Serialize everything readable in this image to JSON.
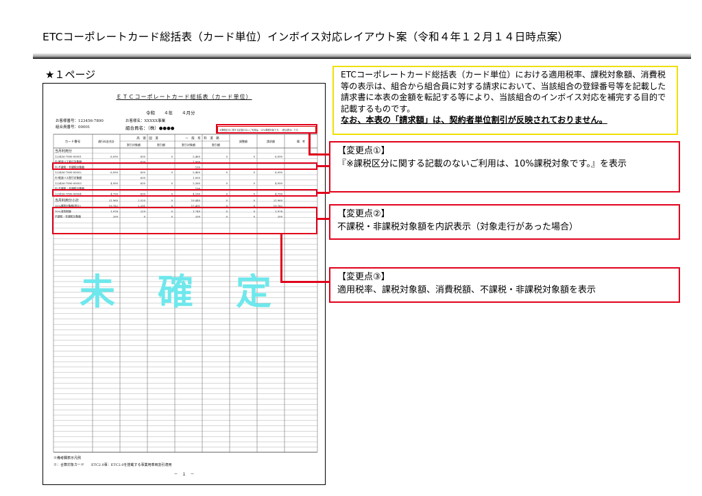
{
  "header": {
    "title": "ETCコーポレートカード総括表（カード単位）インボイス対応レイアウト案（令和４年１２月１４日時点案）"
  },
  "page_label": "★１ページ",
  "document": {
    "title": "ＥＴＣコーポレートカード総括表（カード単位）",
    "period": "令和　　４年　　４月分",
    "customer_no": "お客様番号：123456-7890",
    "customer_name": "お客様名：XXXXX事業",
    "member_no": "組合員番号：00001",
    "member_name": "組合員名：（株）●●●●",
    "stamp_note": "※課税区分に関する記載のないご利用は、10%課税対象です。（税込表示）です。",
    "headers": {
      "card_no": "カード番号",
      "total_before": "通行料金合計",
      "expressway": "高　速　国　道",
      "expressway_sub1": "割引対象額",
      "expressway_sub2": "割引額",
      "toll": "一　般　有　料　道　路",
      "toll_sub1": "割引対象額",
      "toll_sub2": "割引額",
      "adjust": "調整額",
      "billing": "請求額",
      "remarks": "備　考"
    },
    "section_label": "当月利用分",
    "rows": [
      {
        "card": "123456-7890-00001",
        "total": "6,090",
        "ex1": "630",
        "ex2": "0",
        "tl1": "5,460",
        "tl2": "0",
        "adj": "0",
        "bill": "6,090"
      },
      {
        "card": "内 軽減バス割引対象額",
        "total": "",
        "ex1": "630",
        "ex2": "",
        "tl1": "1,000",
        "tl2": "",
        "adj": "",
        "bill": ""
      },
      {
        "card": "内 不課税・非課税対象額",
        "total": "",
        "ex1": "",
        "ex2": "",
        "tl1": "100",
        "tl2": "",
        "adj": "",
        "bill": ""
      },
      {
        "card": "123456-7890-00002",
        "total": "6,090",
        "ex1": "630",
        "ex2": "0",
        "tl1": "5,460",
        "tl2": "0",
        "adj": "0",
        "bill": "6,090"
      },
      {
        "card": "内 軽減バス割引対象額",
        "total": "",
        "ex1": "630",
        "ex2": "",
        "tl1": "1,000",
        "tl2": "",
        "adj": "",
        "bill": ""
      },
      {
        "card": "123456-7890-00003",
        "total": "4,990",
        "ex1": "630",
        "ex2": "0",
        "tl1": "3,360",
        "tl2": "0",
        "adj": "0",
        "bill": "4,990"
      },
      {
        "card": "内 不課税・非課税対象額",
        "total": "",
        "ex1": "",
        "ex2": "",
        "tl1": "100",
        "tl2": "",
        "adj": "",
        "bill": ""
      },
      {
        "card": "123456-7890-00004",
        "total": "4,790",
        "ex1": "630",
        "ex2": "0",
        "tl1": "4,160",
        "tl2": "0",
        "adj": "0",
        "bill": "4,790"
      }
    ],
    "subtotal_label": "当月利用分小計",
    "subtotals": [
      {
        "label": "",
        "total": "21,960",
        "ex1": "2,520",
        "ex2": "0",
        "tl1": "19,440",
        "tl2": "0",
        "adj": "0",
        "bill": "21,960"
      },
      {
        "label": "10%課税対象額(税込)",
        "total": "19,782",
        "ex1": "2,291",
        "ex2": "0",
        "tl1": "17,491",
        "tl2": "0",
        "adj": "0",
        "bill": "19,782"
      },
      {
        "label": "10%消費税額",
        "total": "1,978",
        "ex1": "229",
        "ex2": "0",
        "tl1": "1,749",
        "tl2": "0",
        "adj": "0",
        "bill": "1,978"
      },
      {
        "label": "不課税・非課税対象額",
        "total": "200",
        "ex1": "0",
        "ex2": "0",
        "tl1": "200",
        "tl2": "0",
        "adj": "0",
        "bill": "200"
      }
    ],
    "watermark": "未確定",
    "footer1": "※備考欄表示凡例",
    "footer2": "※：合算対象カード　　ETC2.0事：ETC2.0を搭載する事業用車両割引適用",
    "page_no": "－　１　－"
  },
  "infobox": {
    "text": "ETCコーポレートカード総括表（カード単位）における適用税率、課税対象額、消費税等の表示は、組合から組合員に対する請求において、当該組合の登録番号等を記載した請求書に本表の金額を転記する等により、当該組合のインボイス対応を補完する目的で記載するものです。",
    "bold": "なお、本表の「請求額」は、契約者単位割引が反映されておりません。"
  },
  "callouts": [
    {
      "title": "【変更点①】",
      "body": "『※課税区分に関する記載のないご利用は、10%課税対象です。』を表示"
    },
    {
      "title": "【変更点②】",
      "body": "不課税・非課税対象額を内訳表示（対象走行があった場合）"
    },
    {
      "title": "【変更点③】",
      "body": "適用税率、課税対象額、消費税額、不課税・非課税対象額を表示"
    }
  ],
  "colors": {
    "red": "#e0001b",
    "yellow": "#f0e000",
    "watermark": "#6ee8ec"
  }
}
